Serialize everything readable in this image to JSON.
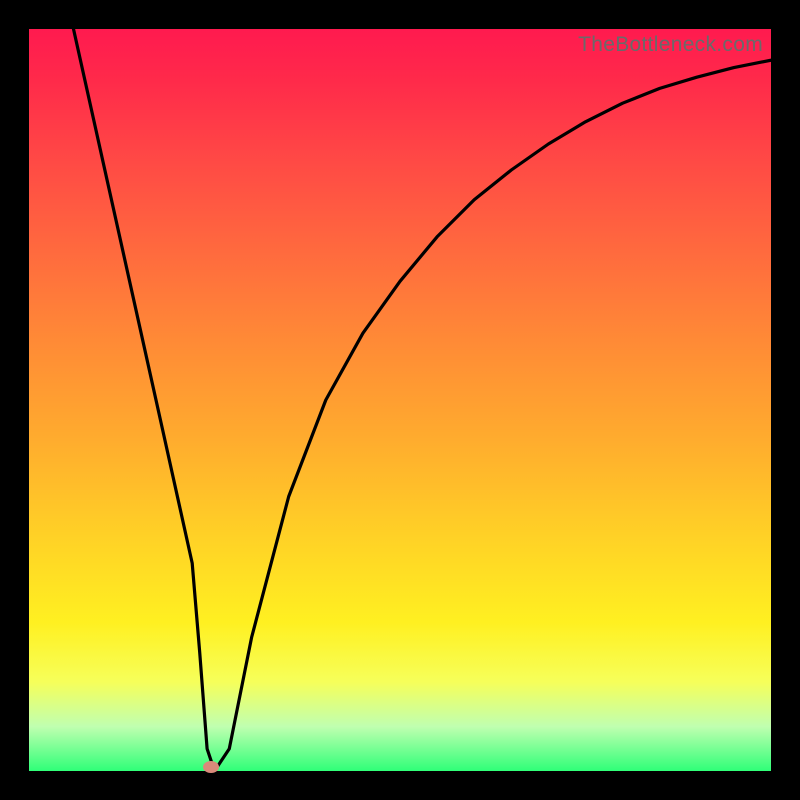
{
  "watermark": "TheBottleneck.com",
  "colors": {
    "background": "#000000",
    "gradient_top": "#ff1a4f",
    "gradient_bottom": "#2fff78",
    "curve": "#000000",
    "marker": "#d98a7a"
  },
  "chart_data": {
    "type": "line",
    "title": "",
    "xlabel": "",
    "ylabel": "",
    "xlim": [
      0,
      100
    ],
    "ylim": [
      0,
      100
    ],
    "series": [
      {
        "name": "curve",
        "x": [
          6,
          10,
          14,
          18,
          20,
          22,
          23,
          24,
          25,
          27,
          30,
          35,
          40,
          45,
          50,
          55,
          60,
          65,
          70,
          75,
          80,
          85,
          90,
          95,
          100
        ],
        "y": [
          100,
          82,
          64,
          46,
          37,
          28,
          16,
          3,
          0,
          3,
          18,
          37,
          50,
          59,
          66,
          72,
          77,
          81,
          84.5,
          87.5,
          90,
          92,
          93.5,
          94.8,
          95.8
        ]
      }
    ],
    "marker": {
      "x": 24.5,
      "y": 0.5
    },
    "grid": false,
    "legend": false
  }
}
